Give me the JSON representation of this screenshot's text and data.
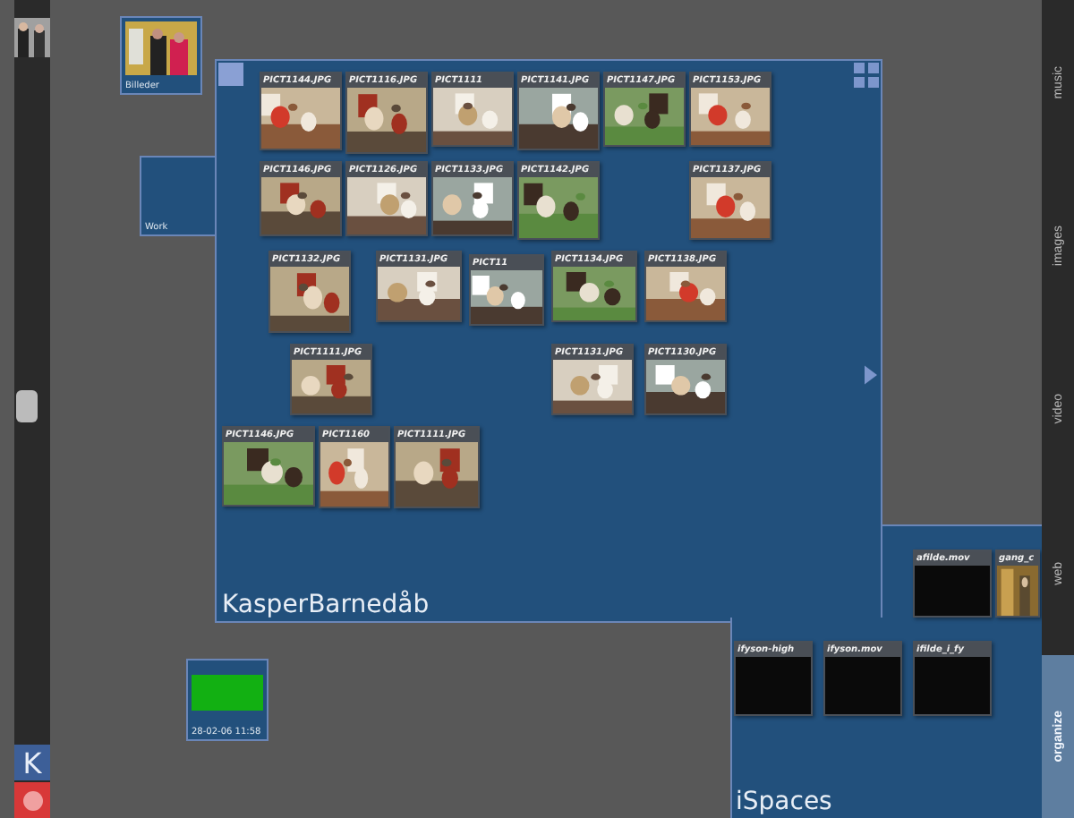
{
  "left_bar": {
    "key_label": "K"
  },
  "desktop_items": [
    {
      "label": "Billeder"
    },
    {
      "label": "Work",
      "kind": "empty"
    },
    {
      "label": "28-02-06 11:58",
      "kind": "green"
    }
  ],
  "space": {
    "title": "KasperBarnedåb",
    "photos": [
      {
        "label": "PICT1144.JPG"
      },
      {
        "label": "PICT1116.JPG"
      },
      {
        "label": "PICT1111"
      },
      {
        "label": "PICT1141.JPG"
      },
      {
        "label": "PICT1147.JPG"
      },
      {
        "label": "PICT1153.JPG"
      },
      {
        "label": "PICT1146.JPG"
      },
      {
        "label": "PICT1126.JPG"
      },
      {
        "label": "PICT1133.JPG"
      },
      {
        "label": "PICT1142.JPG"
      },
      {
        "label": "PICT1137.JPG"
      },
      {
        "label": "PICT1132.JPG"
      },
      {
        "label": "PICT1131.JPG"
      },
      {
        "label": "PICT11"
      },
      {
        "label": "PICT1134.JPG"
      },
      {
        "label": "PICT1138.JPG"
      },
      {
        "label": "PICT1111.JPG"
      },
      {
        "label": "PICT1131.JPG"
      },
      {
        "label": "PICT1130.JPG"
      },
      {
        "label": "PICT1146.JPG"
      },
      {
        "label": "PICT1160"
      },
      {
        "label": "PICT1111.JPG"
      }
    ]
  },
  "ispaces": {
    "title": "iSpaces",
    "items": [
      {
        "label": "afilde.mov",
        "kind": "dark"
      },
      {
        "label": "gang_c"
      },
      {
        "label": "ifyson-high",
        "kind": "dark"
      },
      {
        "label": "ifyson.mov",
        "kind": "dark"
      },
      {
        "label": "ifilde_i_fy",
        "kind": "dark"
      }
    ]
  },
  "sidebar_tabs": [
    {
      "label": "music",
      "selected": false
    },
    {
      "label": "images",
      "selected": false
    },
    {
      "label": "video",
      "selected": false
    },
    {
      "label": "web",
      "selected": false
    },
    {
      "label": "organize",
      "selected": true
    }
  ]
}
